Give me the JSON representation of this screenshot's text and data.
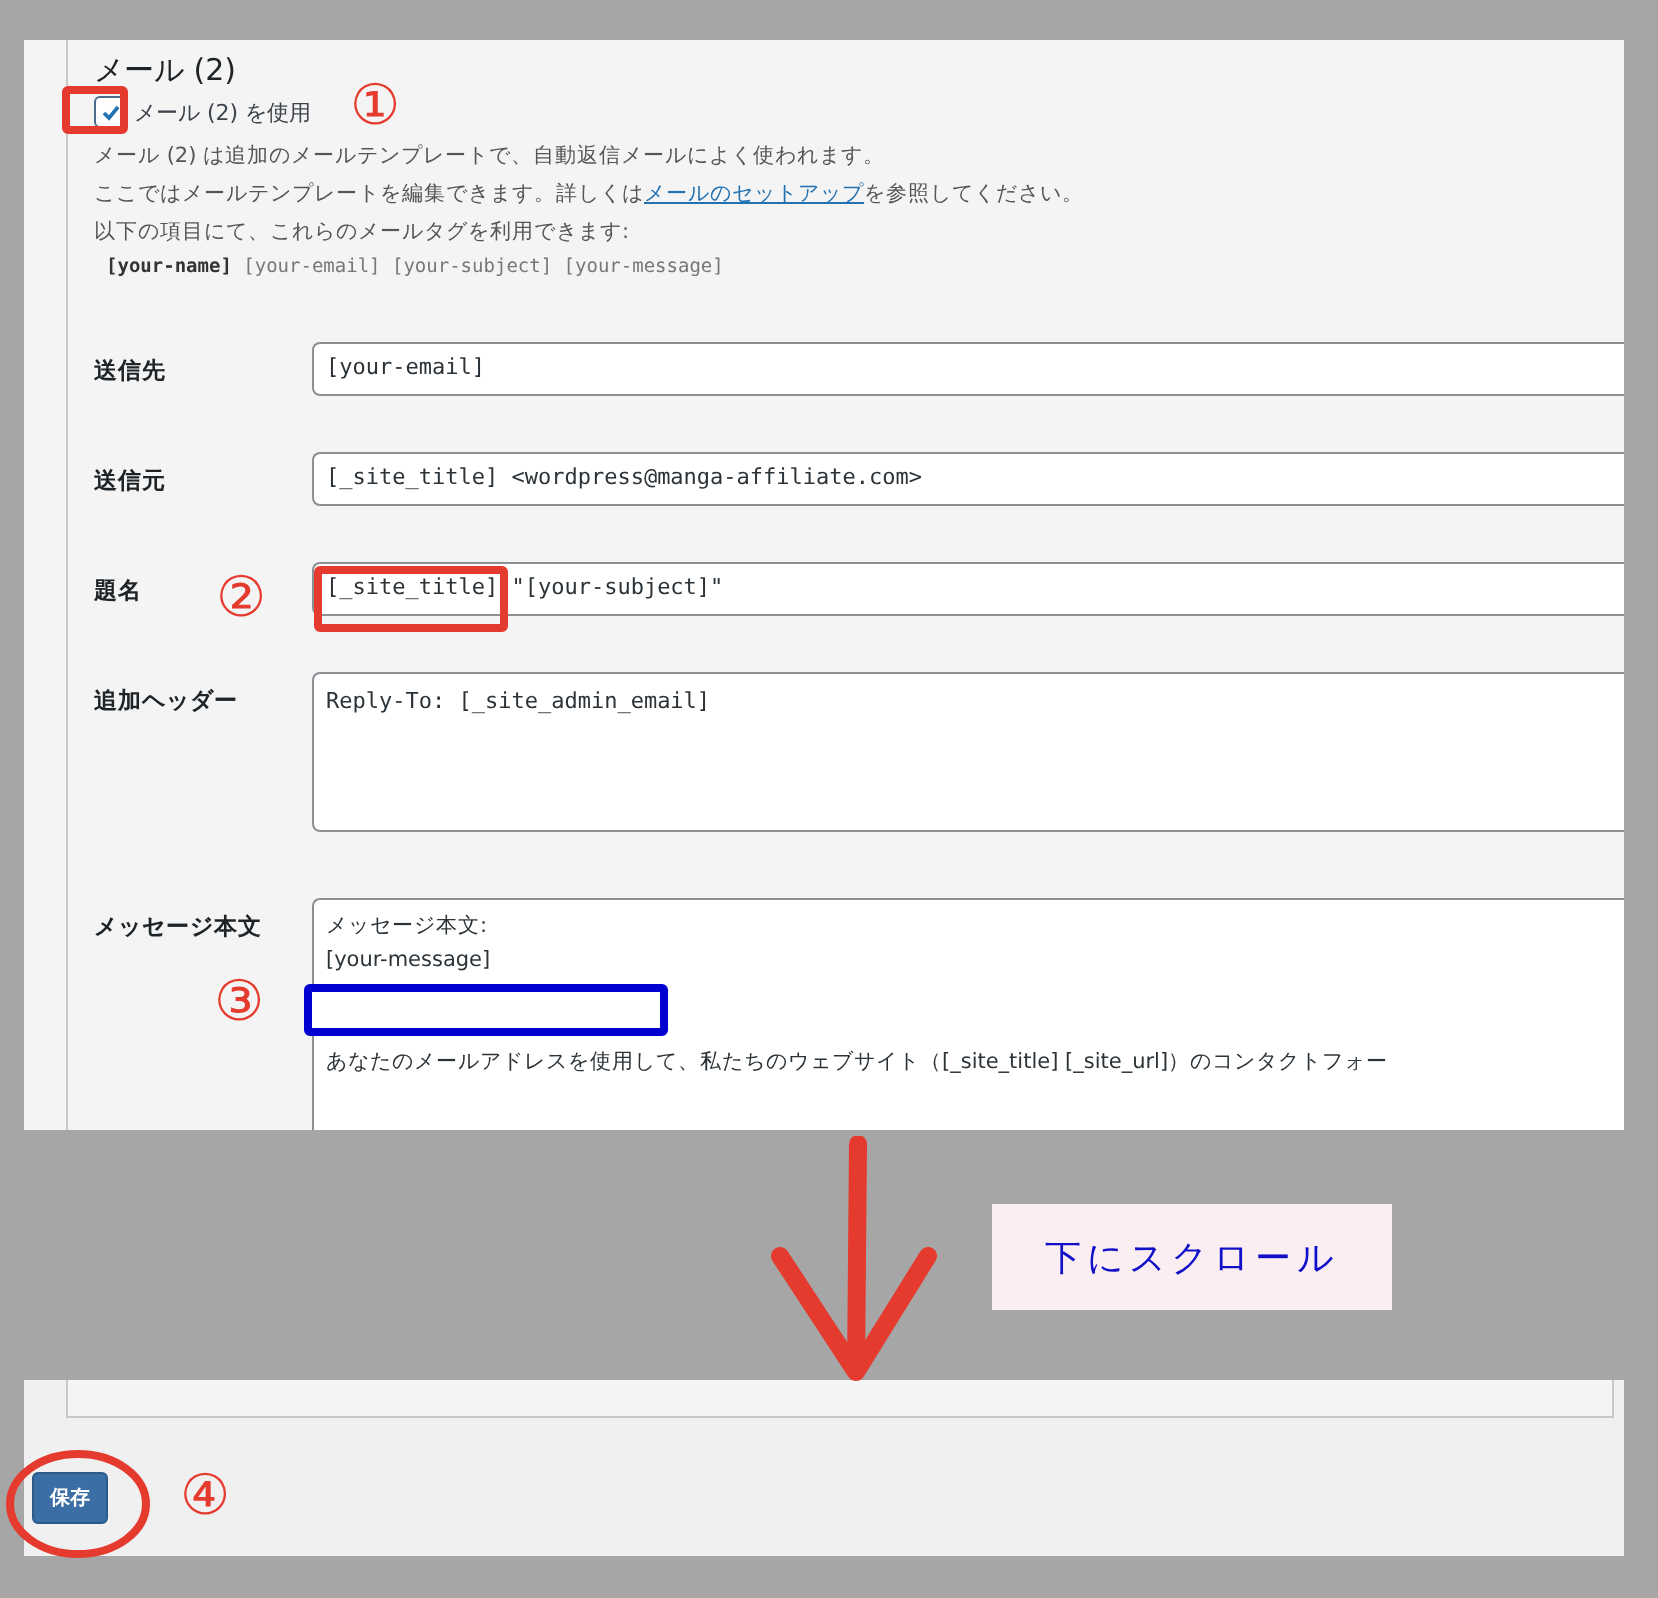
{
  "section": {
    "title": "メール (2)",
    "use_checkbox": {
      "label": "メール (2) を使用",
      "checked": true
    },
    "description": "メール (2) は追加のメールテンプレートで、自動返信メールによく使われます。",
    "help": {
      "before": "ここではメールテンプレートを編集できます。詳しくは",
      "link": "メールのセットアップ",
      "after": "を参照してください。"
    },
    "tags_intro": "以下の項目にて、これらのメールタグを利用できます:",
    "tags": "**[your-name]** [your-email] [your-subject] [your-message]",
    "fields": [
      {
        "kind": "input",
        "label": "送信先",
        "value": "[your-email]"
      },
      {
        "kind": "input",
        "label": "送信元",
        "value": "[_site_title] <wordpress@manga-affiliate.com>"
      },
      {
        "kind": "input",
        "label": "題名",
        "value": "[_site_title] \"[your-subject]\""
      },
      {
        "kind": "textarea",
        "label": "追加ヘッダー",
        "value": "Reply-To: [_site_admin_email]"
      },
      {
        "kind": "textarea",
        "label": "メッセージ本文",
        "value": "メッセージ本文:\n[your-message]\n\n\nあなたのメールアドレスを使用して、私たちのウェブサイト（[_site_title] [_site_url]）のコンタクトフォー"
      }
    ]
  },
  "save_button": "保存",
  "annotations": {
    "markers": [
      "①",
      "②",
      "③",
      "④"
    ],
    "scroll_note": "下にスクロール"
  }
}
